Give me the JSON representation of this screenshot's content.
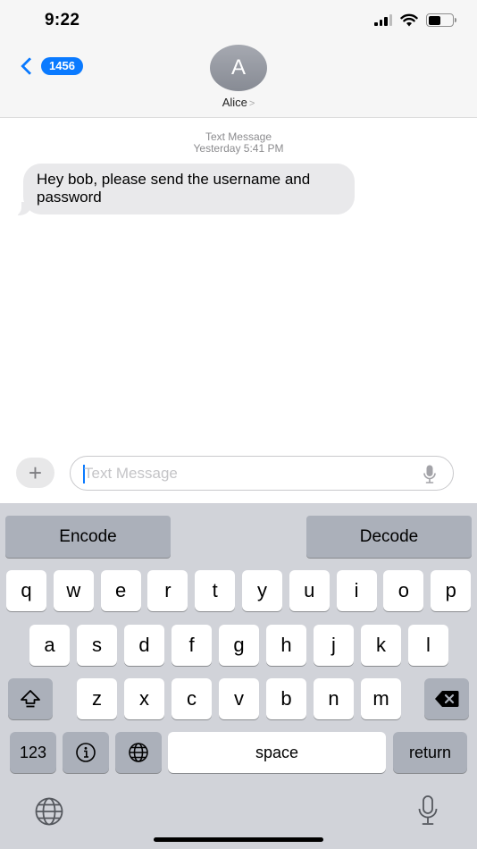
{
  "status_bar": {
    "time": "9:22",
    "icons": [
      "cellular-signal-icon",
      "wifi-icon",
      "battery-icon"
    ],
    "battery_level": 0.5
  },
  "header": {
    "back_icon": "chevron-left-icon",
    "back_badge": "1456",
    "avatar_initial": "A",
    "contact_name": "Alice",
    "contact_chevron": ">"
  },
  "conversation": {
    "service_label": "Text Message",
    "timestamp": "Yesterday 5:41 PM",
    "messages": [
      {
        "direction": "incoming",
        "text": "Hey bob, please send the username and password"
      }
    ]
  },
  "input_bar": {
    "plus_icon": "plus-icon",
    "placeholder": "Text Message",
    "value": "",
    "mic_icon": "microphone-icon"
  },
  "keyboard": {
    "extension": {
      "encode_label": "Encode",
      "decode_label": "Decode"
    },
    "row1": [
      "q",
      "w",
      "e",
      "r",
      "t",
      "y",
      "u",
      "i",
      "o",
      "p"
    ],
    "row2": [
      "a",
      "s",
      "d",
      "f",
      "g",
      "h",
      "j",
      "k",
      "l"
    ],
    "row3": [
      "z",
      "x",
      "c",
      "v",
      "b",
      "n",
      "m"
    ],
    "shift_icon": "shift-icon",
    "delete_icon": "delete-backspace-icon",
    "numbers_label": "123",
    "info_icon": "info-icon",
    "globe_icon": "globe-icon",
    "space_label": "space",
    "return_label": "return",
    "dictation_icon": "microphone-icon"
  },
  "colors": {
    "accent": "#0a7aff",
    "bubble_incoming": "#e9e9eb",
    "keyboard_bg": "#d1d3d9",
    "function_key": "#abb0ba"
  }
}
